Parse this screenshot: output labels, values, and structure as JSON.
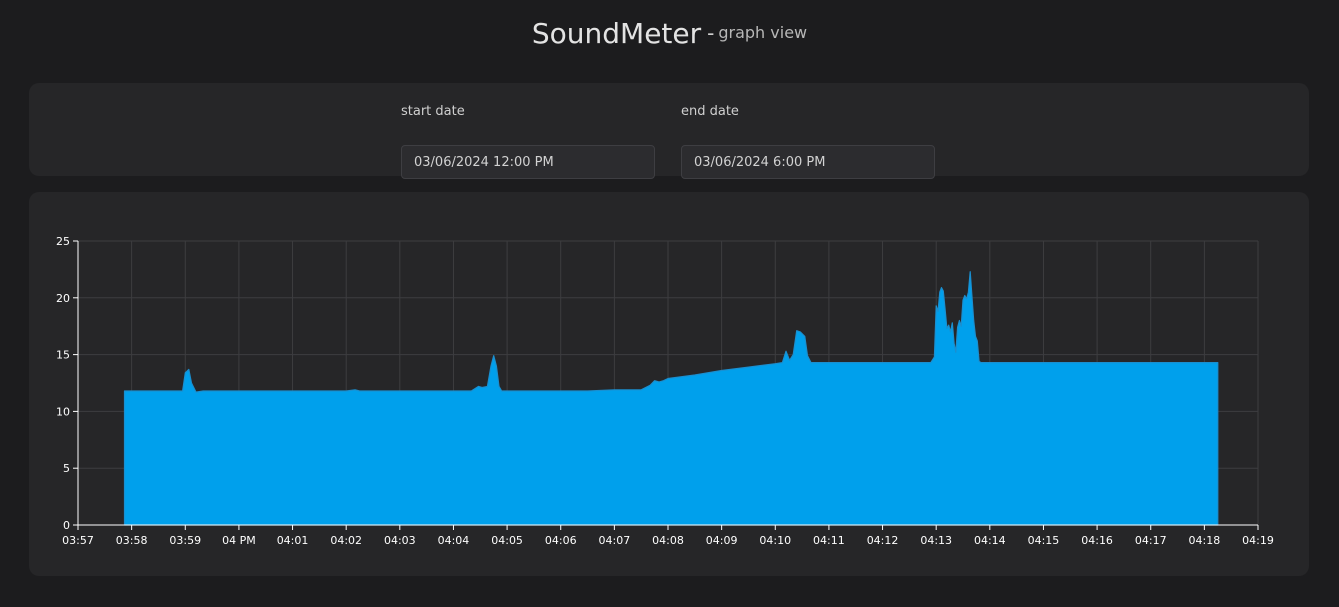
{
  "header": {
    "title": "SoundMeter",
    "separator": "-",
    "subtitle": "graph view"
  },
  "filters": {
    "start_label": "start date",
    "start_value": "03/06/2024 12:00 PM",
    "end_label": "end date",
    "end_value": "03/06/2024 6:00 PM"
  },
  "chart_data": {
    "type": "area",
    "title": "",
    "xlabel": "",
    "ylabel": "",
    "ylim": [
      0,
      25
    ],
    "yticks": [
      0,
      5,
      10,
      15,
      20,
      25
    ],
    "xlim": [
      "03:57",
      "04:19"
    ],
    "xtick_labels": [
      "03:57",
      "03:58",
      "03:59",
      "04 PM",
      "04:01",
      "04:02",
      "04:03",
      "04:04",
      "04:05",
      "04:06",
      "04:07",
      "04:08",
      "04:09",
      "04:10",
      "04:11",
      "04:12",
      "04:13",
      "04:14",
      "04:15",
      "04:16",
      "04:17",
      "04:18",
      "04:19"
    ],
    "grid": true,
    "fill_color": "#00a0ec",
    "line_color": "#1a8fd0",
    "series": [
      {
        "x": [
          "03:57:52",
          "03:58:10",
          "03:58:30",
          "03:58:50",
          "03:58:57",
          "03:59:00",
          "03:59:04",
          "03:59:07",
          "03:59:12",
          "03:59:20",
          "03:59:30",
          "03:59:40",
          "04:00:00",
          "04:00:30",
          "04:01:00",
          "04:01:30",
          "04:02:00",
          "04:02:10",
          "04:02:15",
          "04:02:30",
          "04:03:00",
          "04:03:30",
          "04:04:00",
          "04:04:20",
          "04:04:28",
          "04:04:32",
          "04:04:38",
          "04:04:42",
          "04:04:45",
          "04:04:48",
          "04:04:51",
          "04:04:54",
          "04:05:00",
          "04:05:30",
          "04:06:00",
          "04:06:30",
          "04:07:00",
          "04:07:30",
          "04:07:40",
          "04:07:45",
          "04:07:50",
          "04:07:55",
          "04:08:00",
          "04:08:30",
          "04:09:00",
          "04:09:30",
          "04:10:00",
          "04:10:08",
          "04:10:12",
          "04:10:16",
          "04:10:20",
          "04:10:24",
          "04:10:28",
          "04:10:33",
          "04:10:36",
          "04:10:40",
          "04:11:00",
          "04:11:30",
          "04:12:00",
          "04:12:30",
          "04:12:54",
          "04:12:58",
          "04:13:00",
          "04:13:02",
          "04:13:04",
          "04:13:06",
          "04:13:08",
          "04:13:10",
          "04:13:12",
          "04:13:14",
          "04:13:16",
          "04:13:18",
          "04:13:20",
          "04:13:22",
          "04:13:24",
          "04:13:26",
          "04:13:28",
          "04:13:30",
          "04:13:32",
          "04:13:34",
          "04:13:36",
          "04:13:38",
          "04:13:40",
          "04:13:42",
          "04:13:44",
          "04:13:46",
          "04:13:48",
          "04:13:50",
          "04:13:54",
          "04:14:00",
          "04:14:30",
          "04:15:00",
          "04:15:30",
          "04:16:00",
          "04:16:30",
          "04:17:00",
          "04:17:30",
          "04:18:00",
          "04:18:15"
        ],
        "values": [
          11.8,
          11.8,
          11.8,
          11.8,
          11.8,
          13.4,
          13.7,
          12.5,
          11.7,
          11.8,
          11.8,
          11.8,
          11.8,
          11.8,
          11.8,
          11.8,
          11.8,
          11.9,
          11.8,
          11.8,
          11.8,
          11.8,
          11.8,
          11.8,
          12.2,
          12.1,
          12.2,
          14.0,
          14.9,
          14.0,
          12.2,
          11.8,
          11.8,
          11.8,
          11.8,
          11.8,
          11.9,
          11.9,
          12.3,
          12.7,
          12.6,
          12.7,
          12.9,
          13.2,
          13.6,
          13.9,
          14.2,
          14.3,
          15.3,
          14.5,
          15.0,
          17.1,
          17.0,
          16.6,
          14.9,
          14.3,
          14.3,
          14.3,
          14.3,
          14.3,
          14.3,
          14.8,
          19.3,
          18.8,
          20.5,
          20.9,
          20.6,
          19.0,
          17.3,
          17.6,
          17.0,
          17.8,
          16.0,
          15.2,
          17.4,
          18.0,
          17.5,
          19.8,
          20.2,
          19.9,
          20.5,
          22.3,
          20.2,
          18.0,
          16.6,
          16.2,
          14.4,
          14.3,
          14.3,
          14.3,
          14.3,
          14.3,
          14.3,
          14.3,
          14.3,
          14.3,
          14.3,
          14.3,
          14.3
        ]
      }
    ]
  }
}
